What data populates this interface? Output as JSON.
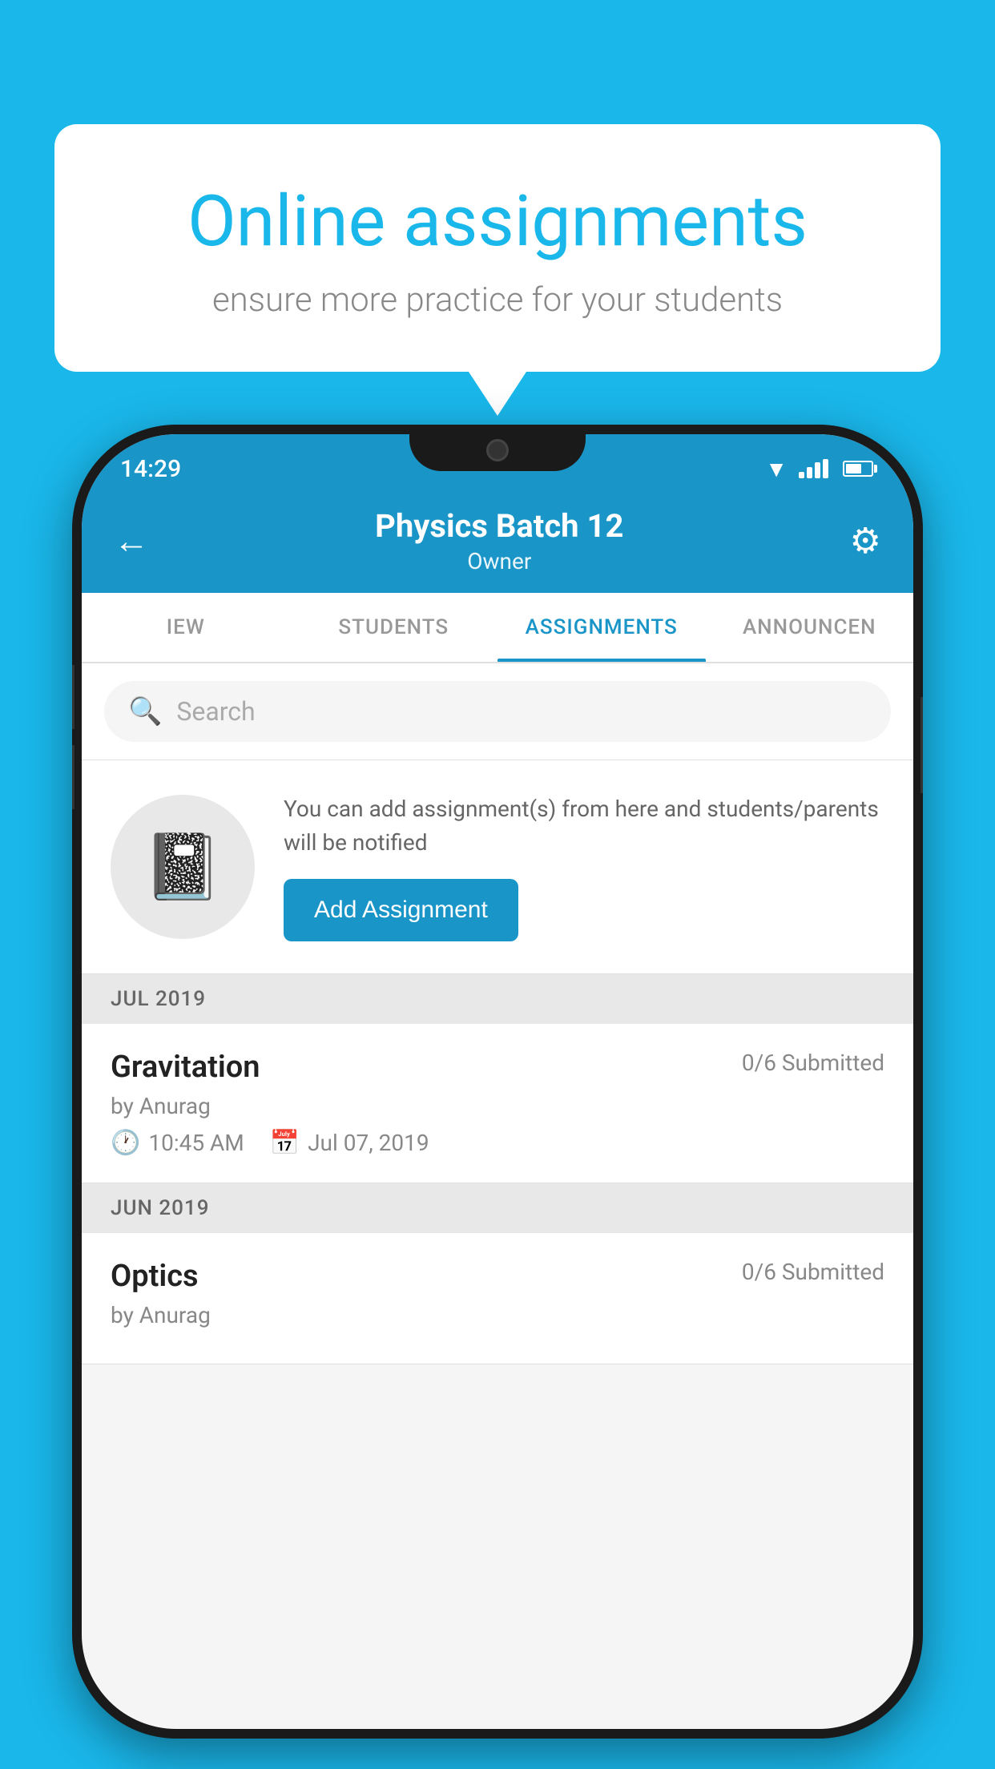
{
  "background_color": "#1ab7ea",
  "speech_bubble": {
    "title": "Online assignments",
    "subtitle": "ensure more practice for your students"
  },
  "status_bar": {
    "time": "14:29"
  },
  "header": {
    "title": "Physics Batch 12",
    "subtitle": "Owner"
  },
  "tabs": [
    {
      "label": "IEW",
      "active": false
    },
    {
      "label": "STUDENTS",
      "active": false
    },
    {
      "label": "ASSIGNMENTS",
      "active": true
    },
    {
      "label": "ANNOUNCEN",
      "active": false
    }
  ],
  "search": {
    "placeholder": "Search"
  },
  "promo_card": {
    "description": "You can add assignment(s) from here and students/parents will be notified",
    "button_label": "Add Assignment"
  },
  "sections": [
    {
      "label": "JUL 2019",
      "assignments": [
        {
          "name": "Gravitation",
          "submitted": "0/6 Submitted",
          "author": "by Anurag",
          "time": "10:45 AM",
          "date": "Jul 07, 2019"
        }
      ]
    },
    {
      "label": "JUN 2019",
      "assignments": [
        {
          "name": "Optics",
          "submitted": "0/6 Submitted",
          "author": "by Anurag",
          "time": "",
          "date": ""
        }
      ]
    }
  ]
}
